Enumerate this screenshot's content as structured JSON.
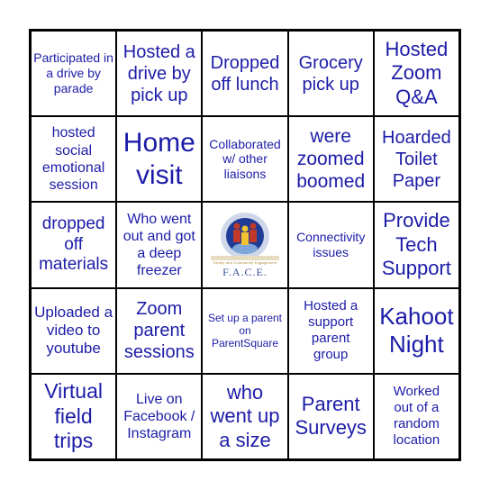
{
  "cells": [
    {
      "text": "Participated in a drive by parade"
    },
    {
      "text": "Hosted a drive by pick up"
    },
    {
      "text": "Dropped off lunch"
    },
    {
      "text": "Grocery pick up"
    },
    {
      "text": "Hosted Zoom Q&A"
    },
    {
      "text": "hosted social emotional session"
    },
    {
      "text": "Home visit"
    },
    {
      "text": "Collaborated w/ other liaisons"
    },
    {
      "text": "were zoomed boomed"
    },
    {
      "text": "Hoarded Toilet Paper"
    },
    {
      "text": "dropped off materials"
    },
    {
      "text": "Who went out and got a deep freezer"
    },
    {
      "text": ""
    },
    {
      "text": "Connectivity issues"
    },
    {
      "text": "Provide Tech Support"
    },
    {
      "text": "Uploaded a video to youtube"
    },
    {
      "text": "Zoom parent sessions"
    },
    {
      "text": "Set up a parent on ParentSquare"
    },
    {
      "text": "Hosted a support parent group"
    },
    {
      "text": "Kahoot Night"
    },
    {
      "text": "Virtual field trips"
    },
    {
      "text": "Live on Facebook / Instagram"
    },
    {
      "text": "who went up a size"
    },
    {
      "text": "Parent Surveys"
    },
    {
      "text": "Worked out of a random location"
    }
  ],
  "logo": {
    "ring_text": "Bakersfield City School District",
    "banner_text": "Family and Community Engagement",
    "acronym": "F.A.C.E."
  },
  "colors": {
    "text": "#1c1ca8",
    "border": "#000000"
  }
}
